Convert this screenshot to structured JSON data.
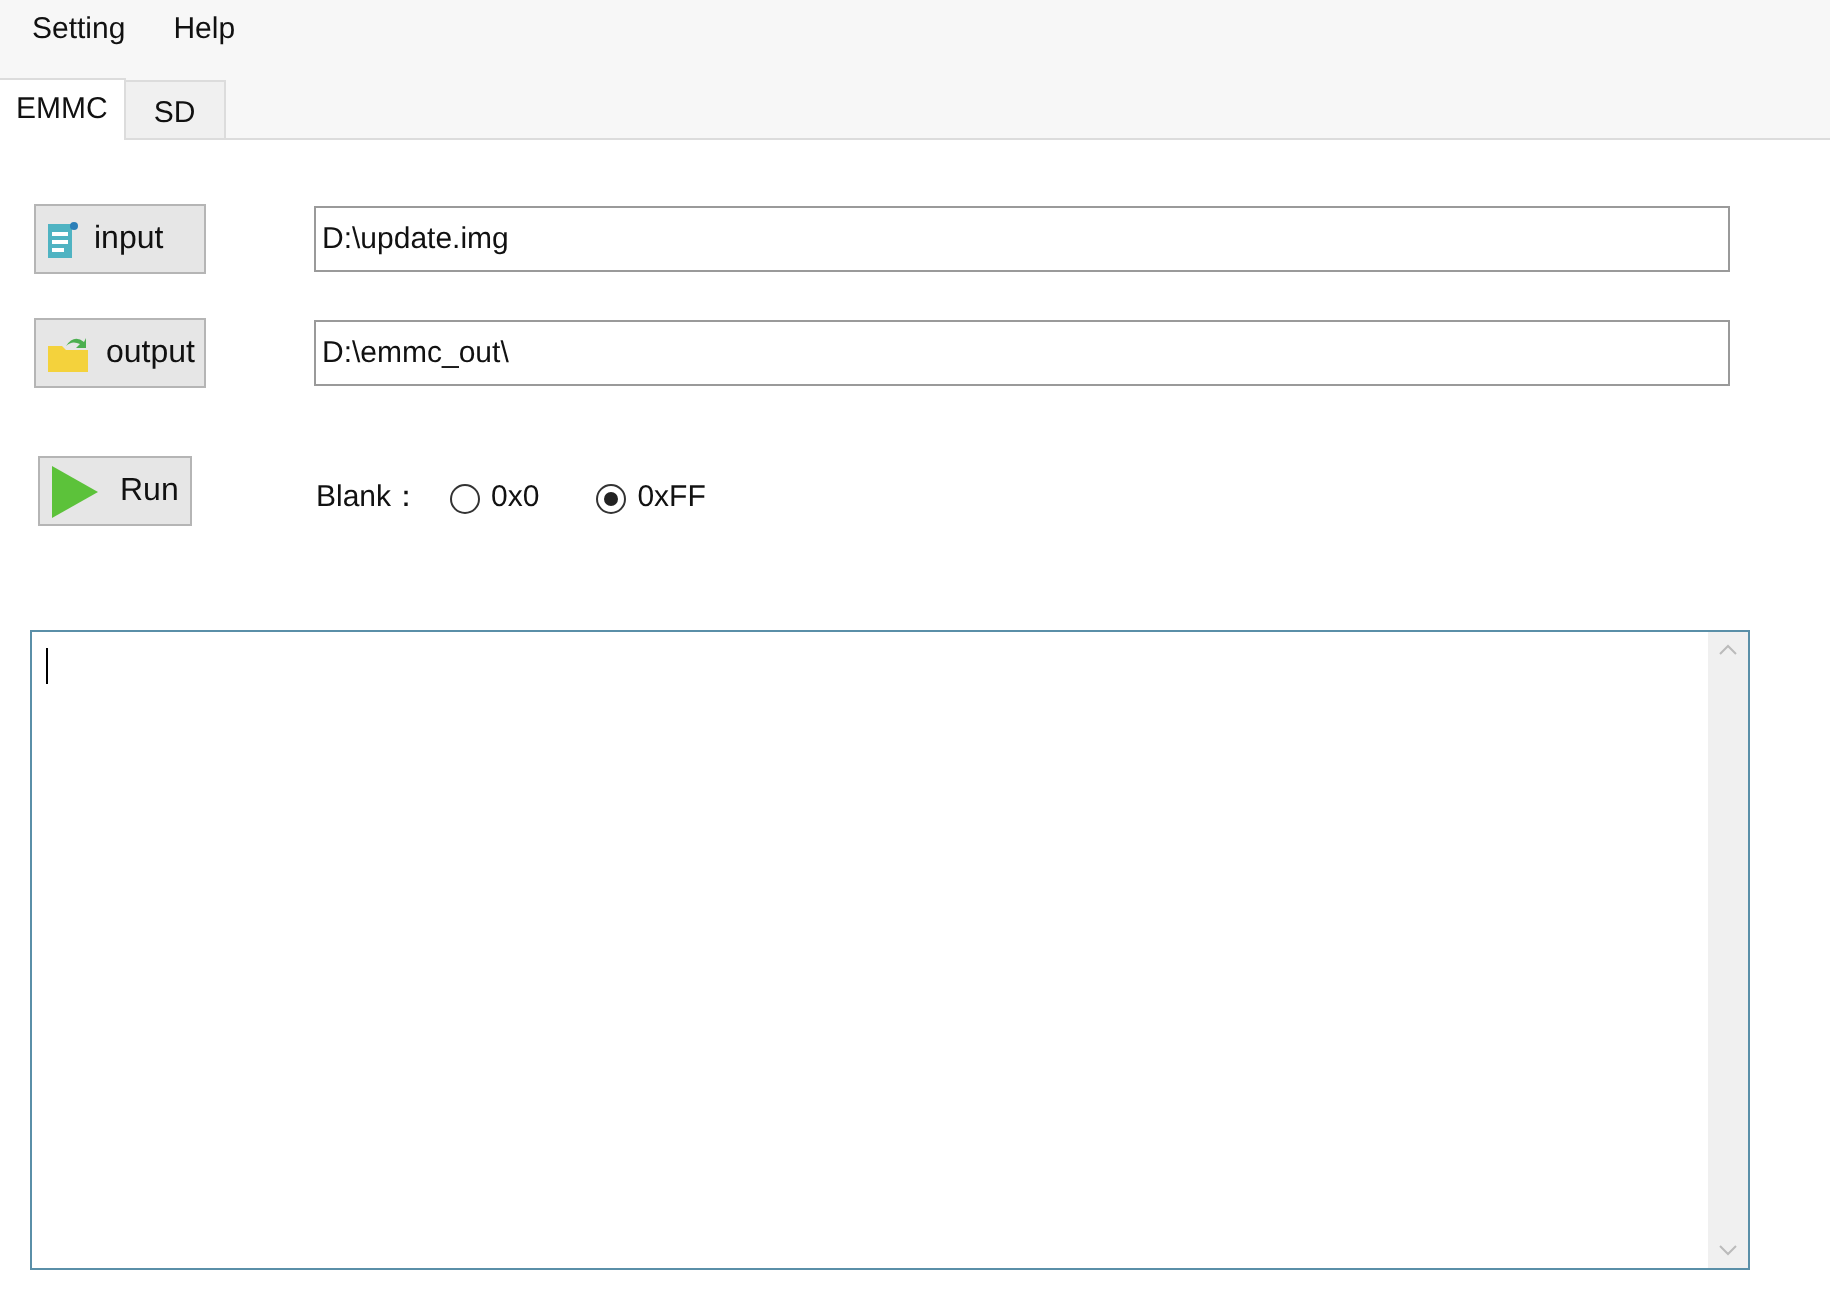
{
  "menu": [
    "Setting",
    "Help"
  ],
  "tabs": [
    {
      "label": "EMMC",
      "selected": true
    },
    {
      "label": "SD",
      "selected": false
    }
  ],
  "rows": [
    {
      "kind": "file",
      "button": "input",
      "value": "D:\\update.img"
    },
    {
      "kind": "folder",
      "button": "output",
      "value": "D:\\emmc_out\\"
    }
  ],
  "run_button": "Run",
  "blank": {
    "label": "Blank：",
    "options": [
      {
        "label": "0x0",
        "selected": false
      },
      {
        "label": "0xFF",
        "selected": true
      }
    ]
  }
}
